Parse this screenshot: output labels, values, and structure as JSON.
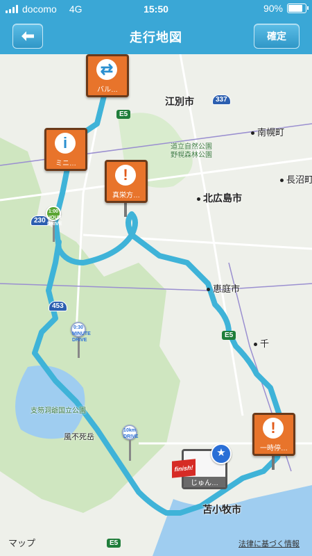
{
  "status_bar": {
    "carrier": "docomo",
    "network": "4G",
    "time": "15:50",
    "battery": "90%",
    "battery_level": 0.9
  },
  "nav": {
    "title": "走行地図",
    "confirm_label": "確定",
    "back_icon": "arrow-left-icon"
  },
  "map": {
    "places": [
      {
        "name": "江別市"
      },
      {
        "name": "南幌町"
      },
      {
        "name": "長沼町"
      },
      {
        "name": "北広島市"
      },
      {
        "name": "恵庭市"
      },
      {
        "name": "千"
      },
      {
        "name": "苫小牧市"
      },
      {
        "name": "支笏洞爺国立公園"
      },
      {
        "name": "風不死岳"
      },
      {
        "name": "道立自然公園\n野幌森林公園"
      }
    ],
    "routes": [
      "E5",
      "337",
      "230",
      "453",
      "E5",
      "E5"
    ],
    "markers": [
      {
        "caption": "真栄方…"
      },
      {
        "caption": "一時停…"
      },
      {
        "caption": "ミニ…"
      },
      {
        "caption": "バル…"
      },
      {
        "caption": "じゅん…"
      }
    ],
    "pins": [
      {
        "label": "1:00\nHOUR\nDRIVE",
        "color": "#5aa532"
      },
      {
        "label": "0:30\nMINUTE\nDRIVE",
        "color": "#ffffff"
      },
      {
        "label": "10km\nDRIVE",
        "color": "#ffffff"
      }
    ],
    "finish_label": "finish!"
  },
  "footer": {
    "maps_label": "マップ",
    "legal_label": "法律に基づく情報"
  }
}
